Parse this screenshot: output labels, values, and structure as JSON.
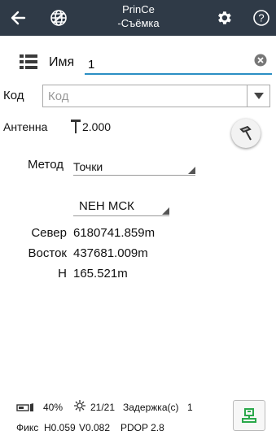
{
  "header": {
    "title_line1": "PrinCe",
    "title_line2": "-Съёмка",
    "back_icon": "arrow-left-icon",
    "globe_icon": "globe-icon",
    "settings_icon": "gear-icon",
    "help_icon": "question-icon"
  },
  "form": {
    "name_label": "Имя",
    "name_value": "1",
    "code_label": "Код",
    "code_placeholder": "Код",
    "antenna_label": "Антенна",
    "antenna_value": "2.000",
    "method_label": "Метод",
    "method_value": "Точки",
    "coord_system_value": "NEH МСК"
  },
  "coords": {
    "north_label": "Север",
    "north_value": "6180741.859m",
    "east_label": "Восток",
    "east_value": "437681.009m",
    "h_label": "H",
    "h_value": "165.521m"
  },
  "status": {
    "battery": "40%",
    "satellites": "21/21",
    "delay_label": "Задержка(с)",
    "delay_value": "1",
    "solution": "Фикс",
    "h_precision": "H0.059",
    "v_precision": "V0.082",
    "pdop": "PDOP 2.8"
  },
  "colors": {
    "header_bg": "#2f3a47",
    "accent": "#2b8fc4",
    "survey_icon": "#2aa84a"
  }
}
